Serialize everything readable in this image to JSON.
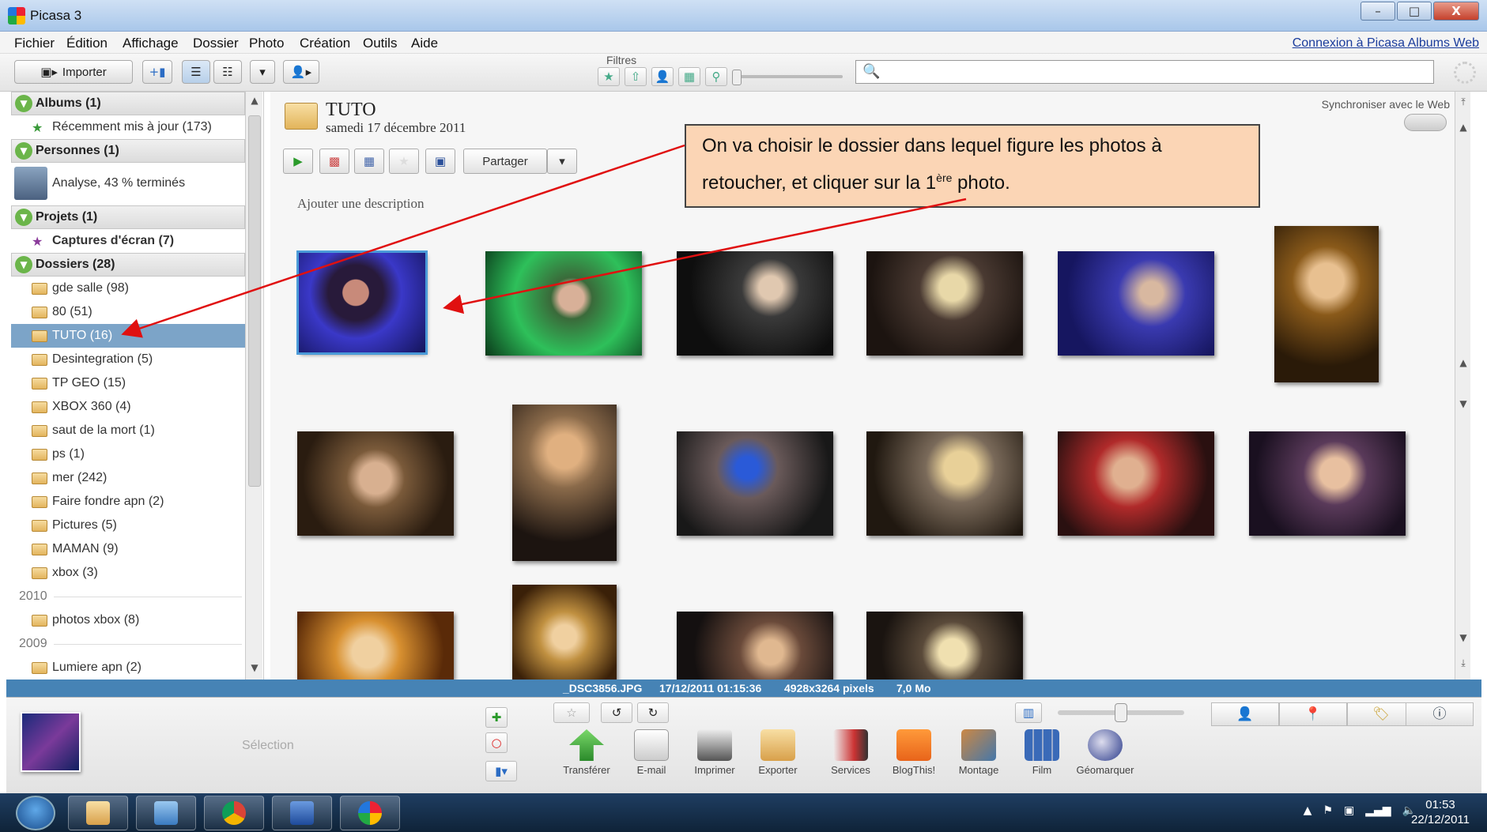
{
  "window": {
    "title": "Picasa 3",
    "controls": [
      "–",
      "□",
      "X"
    ]
  },
  "menu": {
    "items": [
      "Fichier",
      "Édition",
      "Affichage",
      "Dossier",
      "Photo",
      "Création",
      "Outils",
      "Aide"
    ],
    "web_link": "Connexion à Picasa Albums Web"
  },
  "toolbar": {
    "import_label": "Importer",
    "filters_label": "Filtres",
    "search": {
      "value": "",
      "placeholder": ""
    }
  },
  "sidebar": {
    "sections": {
      "albums": "Albums (1)",
      "people": "Personnes (1)",
      "projects": "Projets (1)",
      "folders": "Dossiers (28)"
    },
    "albums_items": [
      "Récemment mis à jour (173)"
    ],
    "people_status": "Analyse, 43 % terminés",
    "projects_items": [
      "Captures d'écran (7)"
    ],
    "folders": [
      "gde salle (98)",
      "80 (51)",
      "TUTO (16)",
      "Desintegration (5)",
      "TP GEO (15)",
      "XBOX 360 (4)",
      "saut de la mort (1)",
      "ps (1)",
      "mer (242)",
      "Faire fondre apn (2)",
      "Pictures (5)",
      "MAMAN (9)",
      "xbox (3)"
    ],
    "years": [
      {
        "year": "2010",
        "folders": [
          "photos xbox (8)"
        ]
      },
      {
        "year": "2009",
        "folders": [
          "Lumiere apn (2)"
        ]
      }
    ],
    "selected_folder": "TUTO (16)"
  },
  "main": {
    "folder_title": "TUTO",
    "folder_date": "samedi 17 décembre 2011",
    "sync_label": "Synchroniser avec le Web",
    "share_label": "Partager",
    "description_placeholder": "Ajouter une description"
  },
  "callout": {
    "text_line1": "On va choisir le dossier dans lequel figure les photos à",
    "text_line2_before": "retoucher, et cliquer sur la 1",
    "text_sup": "ère",
    "text_line2_after": " photo."
  },
  "infobar": {
    "filename": "_DSC3856.JPG",
    "datetime": "17/12/2011 01:15:36",
    "dimensions": "4928x3264 pixels",
    "size": "7,0 Mo"
  },
  "tray": {
    "selection_label": "Sélection",
    "actions": [
      "Transférer",
      "E-mail",
      "Imprimer",
      "Exporter",
      "Services",
      "BlogThis!",
      "Montage",
      "Film",
      "Géomarquer"
    ]
  },
  "taskbar": {
    "time": "01:53",
    "date": "22/12/2011"
  },
  "colors": {
    "selection_blue": "#7ca4c8",
    "infobar_blue": "#4683b5",
    "callout_fill": "#fbd5b5",
    "arrow_red": "#e01010"
  }
}
